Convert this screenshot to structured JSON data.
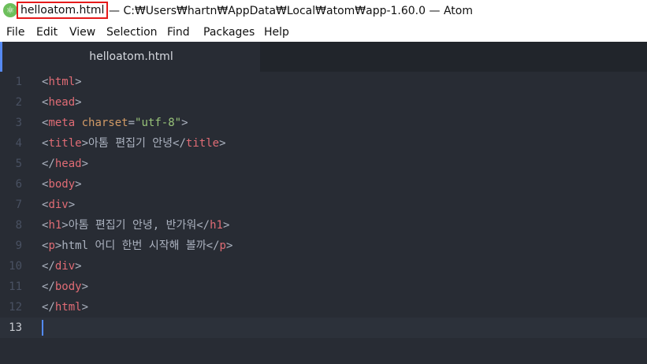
{
  "titlebar": {
    "app_icon_glyph": "⚛",
    "file_name": "helloatom.html",
    "rest": "— C:₩Users₩hartn₩AppData₩Local₩atom₩app-1.60.0 — Atom"
  },
  "menu": [
    "File",
    "Edit",
    "View",
    "Selection",
    "Find",
    "Packages",
    "Help"
  ],
  "tab": {
    "label": "helloatom.html"
  },
  "editor": {
    "line_numbers": [
      "1",
      "2",
      "3",
      "4",
      "5",
      "6",
      "7",
      "8",
      "9",
      "10",
      "11",
      "12",
      "13"
    ],
    "cursor_line": 13,
    "lines": [
      [
        [
          "p",
          "<"
        ],
        [
          "t",
          "html"
        ],
        [
          "p",
          ">"
        ]
      ],
      [
        [
          "p",
          "<"
        ],
        [
          "t",
          "head"
        ],
        [
          "p",
          ">"
        ]
      ],
      [
        [
          "p",
          "<"
        ],
        [
          "t",
          "meta"
        ],
        [
          "p",
          " "
        ],
        [
          "a",
          "charset"
        ],
        [
          "p",
          "="
        ],
        [
          "s",
          "\"utf-8\""
        ],
        [
          "p",
          ">"
        ]
      ],
      [
        [
          "p",
          "<"
        ],
        [
          "t",
          "title"
        ],
        [
          "p",
          ">아톰 편집기 안녕</"
        ],
        [
          "t",
          "title"
        ],
        [
          "p",
          ">"
        ]
      ],
      [
        [
          "p",
          "</"
        ],
        [
          "t",
          "head"
        ],
        [
          "p",
          ">"
        ]
      ],
      [
        [
          "p",
          "<"
        ],
        [
          "t",
          "body"
        ],
        [
          "p",
          ">"
        ]
      ],
      [
        [
          "p",
          "<"
        ],
        [
          "t",
          "div"
        ],
        [
          "p",
          ">"
        ]
      ],
      [
        [
          "p",
          "<"
        ],
        [
          "t",
          "h1"
        ],
        [
          "p",
          ">아톰 편집기 안녕, 반가워</"
        ],
        [
          "t",
          "h1"
        ],
        [
          "p",
          ">"
        ]
      ],
      [
        [
          "p",
          "<"
        ],
        [
          "t",
          "p"
        ],
        [
          "p",
          ">html 어디 한번 시작해 볼까</"
        ],
        [
          "t",
          "p"
        ],
        [
          "p",
          ">"
        ]
      ],
      [
        [
          "p",
          "</"
        ],
        [
          "t",
          "div"
        ],
        [
          "p",
          ">"
        ]
      ],
      [
        [
          "p",
          "</"
        ],
        [
          "t",
          "body"
        ],
        [
          "p",
          ">"
        ]
      ],
      [
        [
          "p",
          "</"
        ],
        [
          "t",
          "html"
        ],
        [
          "p",
          ">"
        ]
      ],
      []
    ]
  }
}
